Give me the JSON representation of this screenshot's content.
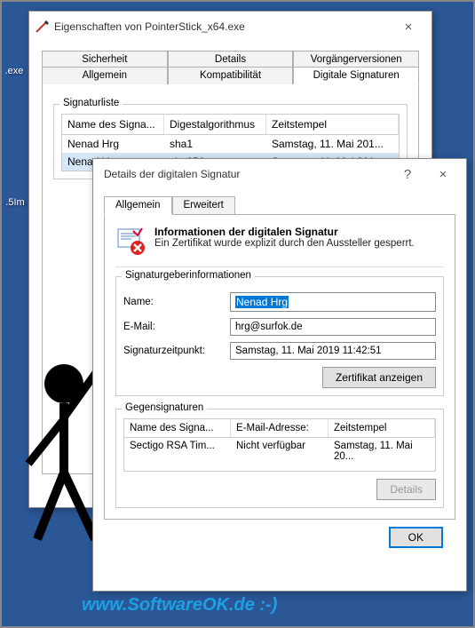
{
  "desktop": {
    "icon1_label": ".exe",
    "icon2_label": ".5Im"
  },
  "dlg1": {
    "title": "Eigenschaften von PointerStick_x64.exe",
    "close": "×",
    "tabs_row1": {
      "sicherheit": "Sicherheit",
      "details": "Details",
      "vorganger": "Vorgängerversionen"
    },
    "tabs_row2": {
      "allgemein": "Allgemein",
      "kompat": "Kompatibilität",
      "digsig": "Digitale Signaturen"
    },
    "group_label": "Signaturliste",
    "columns": {
      "name": "Name des Signa...",
      "digest": "Digestalgorithmus",
      "time": "Zeitstempel"
    },
    "rows": [
      {
        "name": "Nenad Hrg",
        "digest": "sha1",
        "time": "Samstag, 11. Mai 201..."
      },
      {
        "name": "Nenad Hrg",
        "digest": "sha256",
        "time": "Samstag, 11. Mai 201..."
      }
    ]
  },
  "dlg2": {
    "title": "Details der digitalen Signatur",
    "help": "?",
    "close": "×",
    "tabs": {
      "allgemein": "Allgemein",
      "erweitert": "Erweitert"
    },
    "info_title": "Informationen der digitalen Signatur",
    "info_text": "Ein Zertifikat wurde explizit durch den Aussteller gesperrt.",
    "signer_group": "Signaturgeberinformationen",
    "fields": {
      "name_label": "Name:",
      "name_value": "Nenad Hrg",
      "email_label": "E-Mail:",
      "email_value": "hrg@surfok.de",
      "time_label": "Signaturzeitpunkt:",
      "time_value": "Samstag, 11. Mai 2019 11:42:51"
    },
    "view_cert_btn": "Zertifikat anzeigen",
    "counter_group": "Gegensignaturen",
    "counter_columns": {
      "name": "Name des Signa...",
      "email": "E-Mail-Adresse:",
      "time": "Zeitstempel"
    },
    "counter_rows": [
      {
        "name": "Sectigo RSA Tim...",
        "email": "Nicht verfügbar",
        "time": "Samstag, 11. Mai 20..."
      }
    ],
    "details_btn": "Details",
    "ok_btn": "OK"
  },
  "watermark": "www.SoftwareOK.de :-)"
}
